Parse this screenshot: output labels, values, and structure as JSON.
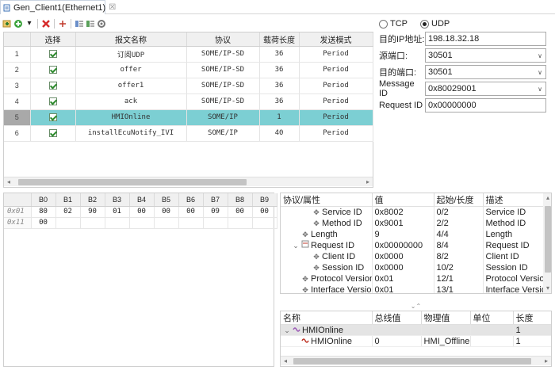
{
  "tab": {
    "title": "Gen_Client1(Ethernet1)",
    "close": "☒"
  },
  "toolbar": {
    "icons": [
      "add-icon",
      "add-green-icon",
      "dropdown-arrow-icon",
      "delete-icon",
      "add-row-icon",
      "list-up-icon",
      "list-down-icon",
      "settings-icon"
    ]
  },
  "messages": {
    "headers": [
      "",
      "选择",
      "报文名称",
      "协议",
      "载荷长度",
      "发送模式"
    ],
    "rows": [
      {
        "idx": "1",
        "name": "订阅UDP",
        "protocol": "SOME/IP-SD",
        "length": "36",
        "mode": "Period"
      },
      {
        "idx": "2",
        "name": "offer",
        "protocol": "SOME/IP-SD",
        "length": "36",
        "mode": "Period"
      },
      {
        "idx": "3",
        "name": "offer1",
        "protocol": "SOME/IP-SD",
        "length": "36",
        "mode": "Period"
      },
      {
        "idx": "4",
        "name": "ack",
        "protocol": "SOME/IP-SD",
        "length": "36",
        "mode": "Period"
      },
      {
        "idx": "5",
        "name": "HMIOnline",
        "protocol": "SOME/IP",
        "length": "1",
        "mode": "Period"
      },
      {
        "idx": "6",
        "name": "installEcuNotify_IVI",
        "protocol": "SOME/IP",
        "length": "40",
        "mode": "Period"
      }
    ],
    "selected_index": 4
  },
  "config": {
    "tcp_label": "TCP",
    "udp_label": "UDP",
    "protocol_selected": "UDP",
    "dest_ip_label": "目的IP地址:",
    "dest_ip": "198.18.32.18",
    "src_port_label": "源端口:",
    "src_port": "30501",
    "dest_port_label": "目的端口:",
    "dest_port": "30501",
    "message_id_label": "Message ID",
    "message_id": "0x80029001",
    "request_id_label": "Request ID",
    "request_id": "0x00000000"
  },
  "bytes": {
    "headers": [
      "",
      "B0",
      "B1",
      "B2",
      "B3",
      "B4",
      "B5",
      "B6",
      "B7",
      "B8",
      "B9"
    ],
    "rows": [
      {
        "label": "0x01",
        "cells": [
          "80",
          "02",
          "90",
          "01",
          "00",
          "00",
          "00",
          "09",
          "00",
          "00"
        ]
      },
      {
        "label": "0x11",
        "cells": [
          "00",
          "",
          "",
          "",
          "",
          "",
          "",
          "",
          "",
          ""
        ]
      }
    ]
  },
  "properties": {
    "headers": [
      "协议/属性",
      "值",
      "起始/长度",
      "描述"
    ],
    "rows": [
      {
        "name": "Service ID",
        "value": "0x8002",
        "pos": "0/2",
        "desc": "Service ID"
      },
      {
        "name": "Method ID",
        "value": "0x9001",
        "pos": "2/2",
        "desc": "Method ID"
      },
      {
        "name": "Length",
        "value": "9",
        "pos": "4/4",
        "desc": "Length"
      },
      {
        "name": "Request ID",
        "value": "0x00000000",
        "pos": "8/4",
        "desc": "Request ID"
      },
      {
        "name": "Client ID",
        "value": "0x0000",
        "pos": "8/2",
        "desc": "Client ID"
      },
      {
        "name": "Session ID",
        "value": "0x0000",
        "pos": "10/2",
        "desc": "Session ID"
      },
      {
        "name": "Protocol Version",
        "value": "0x01",
        "pos": "12/1",
        "desc": "Protocol Version"
      },
      {
        "name": "Interface Version",
        "value": "0x01",
        "pos": "13/1",
        "desc": "Interface Version"
      }
    ]
  },
  "divider_glyph": "⌄⌃",
  "signals": {
    "headers": [
      "名称",
      "总线值",
      "物理值",
      "单位",
      "长度"
    ],
    "rows": [
      {
        "name": "HMIOnline",
        "bus": "",
        "phys": "",
        "unit": "",
        "len": "1"
      },
      {
        "name": "HMIOnline",
        "bus": "0",
        "phys": "HMI_Offline",
        "unit": "",
        "len": "1"
      }
    ]
  },
  "glyphs": {
    "expand": "⌄",
    "gear": "✥",
    "arrow_left": "◂",
    "arrow_right": "▸",
    "arrow_up": "▴",
    "arrow_down": "▾",
    "chevron": "∨"
  }
}
